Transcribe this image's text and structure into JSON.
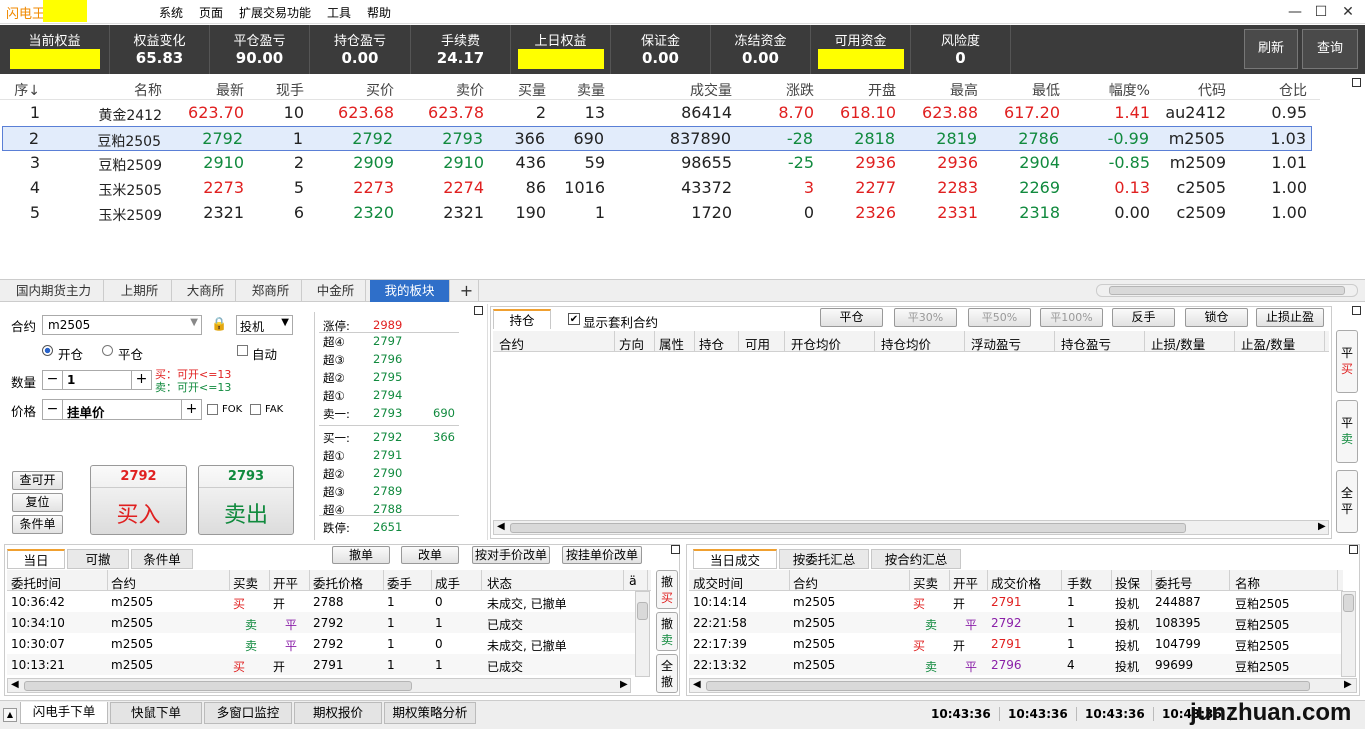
{
  "app": {
    "title": "闪电王"
  },
  "menu": [
    "系统",
    "页面",
    "扩展交易功能",
    "工具",
    "帮助"
  ],
  "window_controls": [
    "—",
    "☐",
    "✕"
  ],
  "account": {
    "cells": [
      {
        "label": "当前权益",
        "value": "",
        "highlight": true
      },
      {
        "label": "权益变化",
        "value": "65.83"
      },
      {
        "label": "平仓盈亏",
        "value": "90.00"
      },
      {
        "label": "持仓盈亏",
        "value": "0.00"
      },
      {
        "label": "手续费",
        "value": "24.17"
      },
      {
        "label": "上日权益",
        "value": "",
        "highlight": true
      },
      {
        "label": "保证金",
        "value": "0.00"
      },
      {
        "label": "冻结资金",
        "value": "0.00"
      },
      {
        "label": "可用资金",
        "value": "",
        "highlight": true
      },
      {
        "label": "风险度",
        "value": "0"
      }
    ],
    "refresh_label": "刷新",
    "query_label": "查询"
  },
  "quotes": {
    "headers": [
      "序↓",
      "名称",
      "最新",
      "现手",
      "买价",
      "卖价",
      "买量",
      "卖量",
      "成交量",
      "涨跌",
      "开盘",
      "最高",
      "最低",
      "幅度%",
      "代码",
      "仓比"
    ],
    "rows": [
      [
        "1",
        "黄金2412",
        "623.70",
        "10",
        "623.68",
        "623.78",
        "2",
        "13",
        "86414",
        "8.70",
        "618.10",
        "623.88",
        "617.20",
        "1.41",
        "au2412",
        "0.95"
      ],
      [
        "2",
        "豆粕2505",
        "2792",
        "1",
        "2792",
        "2793",
        "366",
        "690",
        "837890",
        "-28",
        "2818",
        "2819",
        "2786",
        "-0.99",
        "m2505",
        "1.03"
      ],
      [
        "3",
        "豆粕2509",
        "2910",
        "2",
        "2909",
        "2910",
        "436",
        "59",
        "98655",
        "-25",
        "2936",
        "2936",
        "2904",
        "-0.85",
        "m2509",
        "1.01"
      ],
      [
        "4",
        "玉米2505",
        "2273",
        "5",
        "2273",
        "2274",
        "86",
        "1016",
        "43372",
        "3",
        "2277",
        "2283",
        "2269",
        "0.13",
        "c2505",
        "1.00"
      ],
      [
        "5",
        "玉米2509",
        "2321",
        "6",
        "2320",
        "2321",
        "190",
        "1",
        "1720",
        "0",
        "2326",
        "2331",
        "2318",
        "0.00",
        "c2509",
        "1.00"
      ]
    ],
    "row_colors": [
      [
        "black",
        "black",
        "red",
        "black",
        "red",
        "red",
        "black",
        "black",
        "black",
        "red",
        "red",
        "red",
        "red",
        "red",
        "black",
        "black"
      ],
      [
        "black",
        "black",
        "green",
        "black",
        "green",
        "green",
        "black",
        "black",
        "black",
        "green",
        "green",
        "green",
        "green",
        "green",
        "black",
        "black"
      ],
      [
        "black",
        "black",
        "green",
        "black",
        "green",
        "green",
        "black",
        "black",
        "black",
        "green",
        "red",
        "red",
        "green",
        "green",
        "black",
        "black"
      ],
      [
        "black",
        "black",
        "red",
        "black",
        "red",
        "red",
        "black",
        "black",
        "black",
        "red",
        "red",
        "red",
        "green",
        "red",
        "black",
        "black"
      ],
      [
        "black",
        "black",
        "black",
        "black",
        "green",
        "black",
        "black",
        "black",
        "black",
        "black",
        "red",
        "red",
        "green",
        "black",
        "black",
        "black"
      ]
    ]
  },
  "market_tabs": [
    "国内期货主力",
    "上期所",
    "大商所",
    "郑商所",
    "中金所",
    "我的板块",
    "+"
  ],
  "order": {
    "contract_label": "合约",
    "contract_value": "m2505",
    "hedge_value": "投机",
    "open_label": "开仓",
    "close_label": "平仓",
    "auto_label": "自动",
    "qty_label": "数量",
    "qty_value": "1",
    "buy_hint": "买：可开<=13",
    "sell_hint": "卖：可开<=13",
    "price_label": "价格",
    "price_value": "挂单价",
    "fok_label": "FOK",
    "fak_label": "FAK",
    "query_open_label": "查可开",
    "reset_label": "复位",
    "condition_label": "条件单",
    "buy_price": "2792",
    "buy_label": "买入",
    "sell_price": "2793",
    "sell_label": "卖出"
  },
  "depth": {
    "limit_up_label": "涨停:",
    "limit_up": "2989",
    "asks": [
      [
        "超④",
        "2797",
        ""
      ],
      [
        "超③",
        "2796",
        ""
      ],
      [
        "超②",
        "2795",
        ""
      ],
      [
        "超①",
        "2794",
        ""
      ],
      [
        "卖一:",
        "2793",
        "690"
      ]
    ],
    "bids": [
      [
        "买一:",
        "2792",
        "366"
      ],
      [
        "超①",
        "2791",
        ""
      ],
      [
        "超②",
        "2790",
        ""
      ],
      [
        "超③",
        "2789",
        ""
      ],
      [
        "超④",
        "2788",
        ""
      ]
    ],
    "limit_down_label": "跌停:",
    "limit_down": "2651"
  },
  "positions": {
    "tab_label": "持仓",
    "show_arb_label": "显示套利合约",
    "buttons": [
      "平仓",
      "平30%",
      "平50%",
      "平100%",
      "反手",
      "锁仓",
      "止损止盈"
    ],
    "headers": [
      "合约",
      "方向",
      "属性",
      "持仓",
      "可用",
      "开仓均价",
      "持仓均价",
      "浮动盈亏",
      "持仓盈亏",
      "止损/数量",
      "止盈/数量"
    ],
    "side_buttons": [
      "平买",
      "平卖",
      "全平"
    ]
  },
  "orders": {
    "tabs": [
      "当日",
      "可撤",
      "条件单"
    ],
    "buttons": [
      "撤单",
      "改单",
      "按对手价改单",
      "按挂单价改单"
    ],
    "headers": [
      "委托时间",
      "合约",
      "买卖",
      "开平",
      "委托价格",
      "委手",
      "成手",
      "状态",
      "ä"
    ],
    "rows": [
      [
        "10:36:42",
        "m2505",
        "买",
        "开",
        "2788",
        "1",
        "0",
        "未成交, 已撤单"
      ],
      [
        "10:34:10",
        "m2505",
        "卖",
        "平",
        "2792",
        "1",
        "1",
        "已成交"
      ],
      [
        "10:30:07",
        "m2505",
        "卖",
        "平",
        "2792",
        "1",
        "0",
        "未成交, 已撤单"
      ],
      [
        "10:13:21",
        "m2505",
        "买",
        "开",
        "2791",
        "1",
        "1",
        "已成交"
      ]
    ],
    "side_buttons": [
      "撤买",
      "撤卖",
      "全撤"
    ]
  },
  "trades": {
    "tabs": [
      "当日成交",
      "按委托汇总",
      "按合约汇总"
    ],
    "headers": [
      "成交时间",
      "合约",
      "买卖",
      "开平",
      "成交价格",
      "手数",
      "投保",
      "委托号",
      "名称"
    ],
    "rows": [
      [
        "10:14:14",
        "m2505",
        "买",
        "开",
        "2791",
        "1",
        "投机",
        "244887",
        "豆粕2505"
      ],
      [
        "22:21:58",
        "m2505",
        "卖",
        "平",
        "2792",
        "1",
        "投机",
        "108395",
        "豆粕2505"
      ],
      [
        "22:17:39",
        "m2505",
        "买",
        "开",
        "2791",
        "1",
        "投机",
        "104799",
        "豆粕2505"
      ],
      [
        "22:13:32",
        "m2505",
        "卖",
        "平",
        "2796",
        "4",
        "投机",
        "99699",
        "豆粕2505"
      ]
    ]
  },
  "bottom_tabs": [
    "闪电手下单",
    "快鼠下单",
    "多窗口监控",
    "期权报价",
    "期权策略分析"
  ],
  "clocks": [
    "10:43:36",
    "10:43:36",
    "10:43:36",
    "10:43:36"
  ],
  "watermark": "junzhuan.com",
  "colors": {
    "red": "#e02020",
    "green": "#118a3e",
    "purple": "#8a1fa8",
    "highlight": "#ffff00",
    "accent": "#2f6fc9"
  }
}
